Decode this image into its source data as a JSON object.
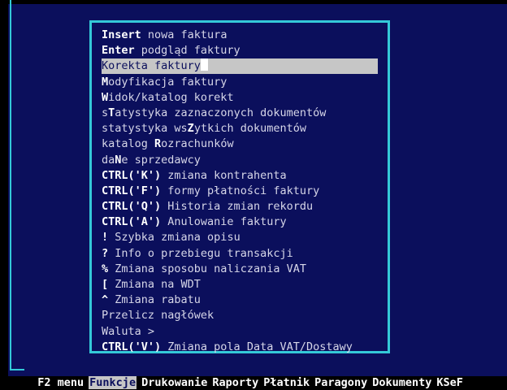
{
  "menu_items": [
    {
      "pre": "",
      "key": "Insert",
      "post": " nowa faktura"
    },
    {
      "pre": "",
      "key": "Enter",
      "post": " podgląd faktury"
    },
    {
      "pre": "",
      "key": "",
      "post": "Korekta faktury",
      "selected": true
    },
    {
      "pre": "",
      "key": "M",
      "post": "odyfikacja faktury"
    },
    {
      "pre": "",
      "key": "W",
      "post": "idok/katalog korekt"
    },
    {
      "pre": "s",
      "key": "T",
      "post": "atystyka zaznaczonych dokumentów"
    },
    {
      "pre": "statystyka ws",
      "key": "Z",
      "post": "ytkich dokumentów"
    },
    {
      "pre": "katalog ",
      "key": "R",
      "post": "ozrachunków"
    },
    {
      "pre": "da",
      "key": "N",
      "post": "e sprzedawcy"
    },
    {
      "pre": "",
      "key": "CTRL('K')",
      "post": " zmiana kontrahenta"
    },
    {
      "pre": "",
      "key": "CTRL('F')",
      "post": " formy płatności faktury"
    },
    {
      "pre": "",
      "key": "CTRL('Q')",
      "post": " Historia zmian rekordu"
    },
    {
      "pre": "",
      "key": "CTRL('A')",
      "post": " Anulowanie faktury"
    },
    {
      "pre": "",
      "key": "!",
      "post": " Szybka zmiana opisu"
    },
    {
      "pre": "",
      "key": "?",
      "post": " Info o przebiegu transakcji"
    },
    {
      "pre": "",
      "key": "%",
      "post": " Zmiana sposobu naliczania VAT"
    },
    {
      "pre": "",
      "key": "[",
      "post": " Zmiana na WDT"
    },
    {
      "pre": "",
      "key": "^",
      "post": " Zmiana rabatu"
    },
    {
      "pre": "",
      "key": "",
      "post": "Przelicz nagłówek"
    },
    {
      "pre": "",
      "key": "",
      "post": "Waluta >"
    },
    {
      "pre": "",
      "key": "CTRL('V')",
      "post": " Zmiana pola Data VAT/Dostawy"
    }
  ],
  "menubar": {
    "f2": "F2 menu",
    "items": [
      "Funkcje",
      "Drukowanie",
      "Raporty",
      "Płatnik",
      "Paragony",
      "Dokumenty",
      "KSeF"
    ],
    "active_index": 0
  },
  "colors": {
    "background": "#0b0f5c",
    "border": "#34c9d8",
    "highlight": "#c6c6c6",
    "text": "#d6d6e8",
    "hotkey": "#ffffff"
  }
}
